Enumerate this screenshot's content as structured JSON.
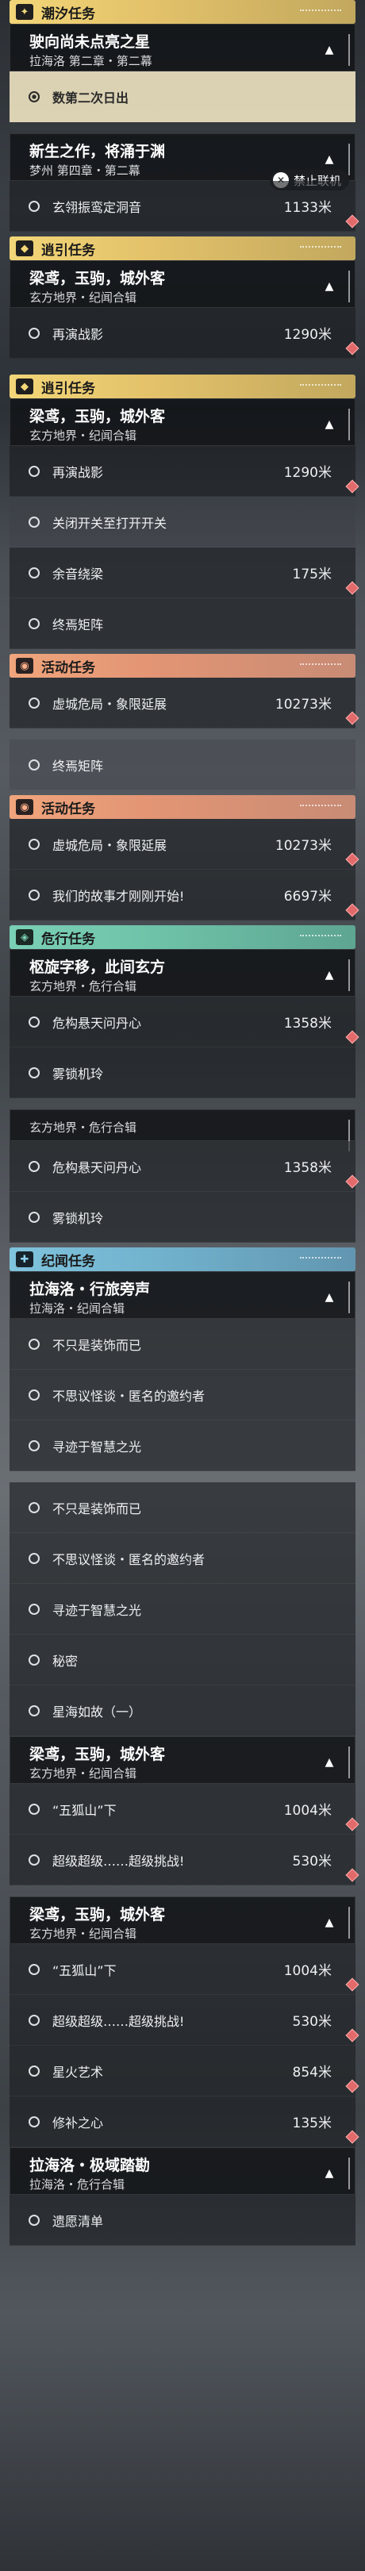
{
  "colors": {
    "yellow": "#f3d678",
    "orange": "#f0a57c",
    "green": "#7ad0b5",
    "blue": "#7fc3dd",
    "selected_row": "#f2e8c4",
    "gem": "#e26a6a"
  },
  "online_ban": "禁止联机",
  "sections": [
    {
      "kind": "cat",
      "color": "yellow",
      "badge": "✦",
      "name": "潮汐任务",
      "gap": false
    },
    {
      "kind": "card",
      "title": "驶向尚未点亮之星",
      "sub": "拉海洛 第二章・第二幕"
    },
    {
      "kind": "row",
      "name": "数第二次日出",
      "selected": true
    },
    {
      "kind": "spacer"
    },
    {
      "kind": "card",
      "title": "新生之作，将涌于渊",
      "sub": "梦州 第四章・第二幕"
    },
    {
      "kind": "row",
      "name": "玄翎振鸾定洞音",
      "dist": "1133米"
    },
    {
      "kind": "cat",
      "color": "yellow",
      "badge": "◆",
      "name": "逍引任务"
    },
    {
      "kind": "card",
      "title": "梁鸢，玉驹，城外客",
      "sub": "玄方地界・纪闻合辑"
    },
    {
      "kind": "row",
      "name": "再演战影",
      "dist": "1290米"
    },
    {
      "kind": "spacer"
    },
    {
      "kind": "cat",
      "color": "yellow",
      "badge": "◆",
      "name": "逍引任务"
    },
    {
      "kind": "card",
      "title": "梁鸢，玉驹，城外客",
      "sub": "玄方地界・纪闻合辑"
    },
    {
      "kind": "row",
      "name": "再演战影",
      "dist": "1290米"
    },
    {
      "kind": "row",
      "name": "关闭开关至打开开关",
      "dim": true
    },
    {
      "kind": "row",
      "name": "余音绕梁",
      "dist": "175米"
    },
    {
      "kind": "row",
      "name": "终焉矩阵"
    },
    {
      "kind": "cat",
      "color": "orange",
      "badge": "◉",
      "name": "活动任务"
    },
    {
      "kind": "row",
      "name": "虚城危局・象限延展",
      "dist": "10273米"
    },
    {
      "kind": "spacer"
    },
    {
      "kind": "row",
      "name": "终焉矩阵",
      "dim": true
    },
    {
      "kind": "cat",
      "color": "orange",
      "badge": "◉",
      "name": "活动任务"
    },
    {
      "kind": "row",
      "name": "虚城危局・象限延展",
      "dist": "10273米"
    },
    {
      "kind": "row",
      "name": "我们的故事才刚刚开始!",
      "dist": "6697米"
    },
    {
      "kind": "cat",
      "color": "green",
      "badge": "◈",
      "name": "危行任务"
    },
    {
      "kind": "card",
      "title": "枢旋字移，此间玄方",
      "sub": "玄方地界・危行合辑"
    },
    {
      "kind": "row",
      "name": "危构悬天问丹心",
      "dist": "1358米"
    },
    {
      "kind": "row",
      "name": "雾锁机玲"
    },
    {
      "kind": "spacer"
    },
    {
      "kind": "card",
      "title": "",
      "sub": "玄方地界・危行合辑",
      "plain": true
    },
    {
      "kind": "row",
      "name": "危构悬天问丹心",
      "dist": "1358米"
    },
    {
      "kind": "row",
      "name": "雾锁机玲"
    },
    {
      "kind": "cat",
      "color": "blue",
      "badge": "✚",
      "name": "纪闻任务"
    },
    {
      "kind": "card",
      "title": "拉海洛・行旅旁声",
      "sub": "拉海洛・纪闻合辑"
    },
    {
      "kind": "row",
      "name": "不只是装饰而已"
    },
    {
      "kind": "row",
      "name": "不思议怪谈・匿名的邀约者"
    },
    {
      "kind": "row",
      "name": "寻迹于智慧之光"
    },
    {
      "kind": "spacer"
    },
    {
      "kind": "row",
      "name": "不只是装饰而已"
    },
    {
      "kind": "row",
      "name": "不思议怪谈・匿名的邀约者"
    },
    {
      "kind": "row",
      "name": "寻迹于智慧之光"
    },
    {
      "kind": "row",
      "name": "秘密"
    },
    {
      "kind": "row",
      "name": "星海如故（一）"
    },
    {
      "kind": "card",
      "title": "梁鸢，玉驹，城外客",
      "sub": "玄方地界・纪闻合辑"
    },
    {
      "kind": "row",
      "name": "“五狐山”下",
      "dist": "1004米"
    },
    {
      "kind": "row",
      "name": "超级超级……超级挑战!",
      "dist": "530米"
    },
    {
      "kind": "spacer"
    },
    {
      "kind": "card",
      "title": "梁鸢，玉驹，城外客",
      "sub": "玄方地界・纪闻合辑"
    },
    {
      "kind": "row",
      "name": "“五狐山”下",
      "dist": "1004米"
    },
    {
      "kind": "row",
      "name": "超级超级……超级挑战!",
      "dist": "530米"
    },
    {
      "kind": "row",
      "name": "星火艺术",
      "dist": "854米"
    },
    {
      "kind": "row",
      "name": "修补之心",
      "dist": "135米"
    },
    {
      "kind": "card",
      "title": "拉海洛・极域踏勘",
      "sub": "拉海洛・危行合辑"
    },
    {
      "kind": "row",
      "name": "遗愿清单"
    }
  ]
}
